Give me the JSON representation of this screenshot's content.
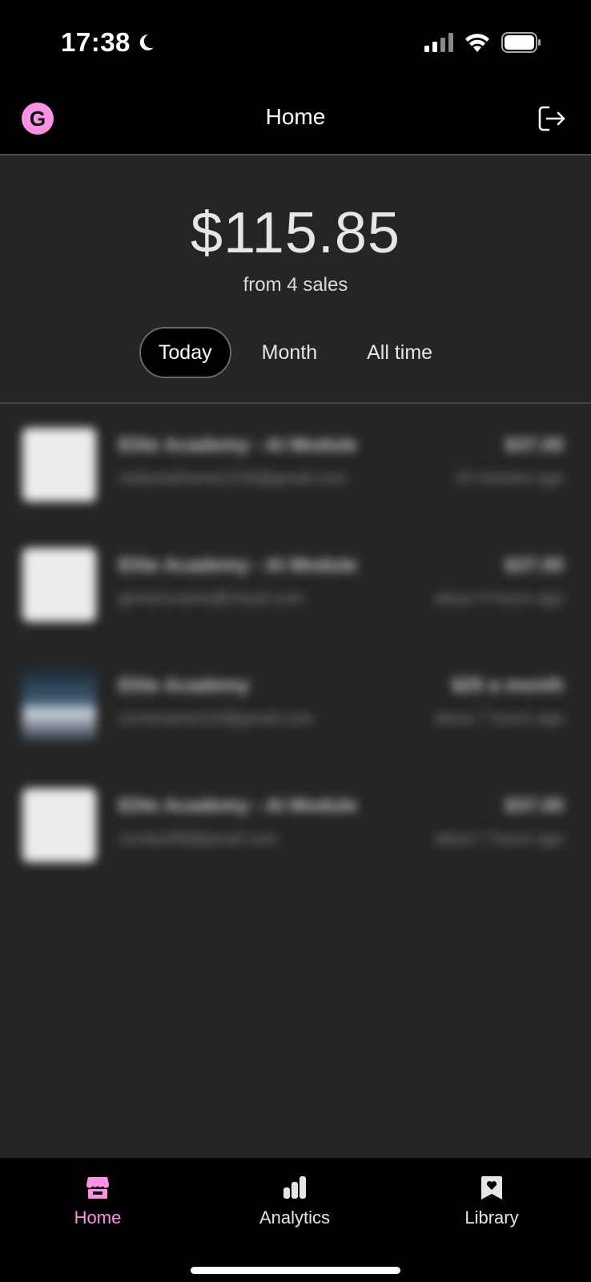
{
  "status_bar": {
    "time": "17:38"
  },
  "header": {
    "title": "Home",
    "logo_letter": "G"
  },
  "summary": {
    "amount": "$115.85",
    "subtitle": "from 4 sales",
    "tabs": [
      {
        "label": "Today",
        "active": true
      },
      {
        "label": "Month",
        "active": false
      },
      {
        "label": "All time",
        "active": false
      }
    ]
  },
  "sales": [
    {
      "title": "Elite Academy - AI Module",
      "email": "redactedname1234@gmail.com",
      "price": "$37.00",
      "time": "19 minutes ago"
    },
    {
      "title": "Elite Academy - AI Module",
      "email": "genericname@icloud.com",
      "price": "$37.00",
      "time": "about 4 hours ago"
    },
    {
      "title": "Elite Academy",
      "email": "somename123@gmail.com",
      "price": "$25 a month",
      "time": "about 7 hours ago"
    },
    {
      "title": "Elite Academy - AI Module",
      "email": "contact99@gmail.com",
      "price": "$37.00",
      "time": "about 7 hours ago"
    }
  ],
  "bottom_nav": {
    "items": [
      {
        "label": "Home",
        "icon": "store-icon",
        "active": true
      },
      {
        "label": "Analytics",
        "icon": "bar-chart-icon",
        "active": false
      },
      {
        "label": "Library",
        "icon": "bookmark-heart-icon",
        "active": false
      }
    ]
  },
  "colors": {
    "accent": "#ff90e8",
    "background": "#252525",
    "bar": "#000000"
  }
}
